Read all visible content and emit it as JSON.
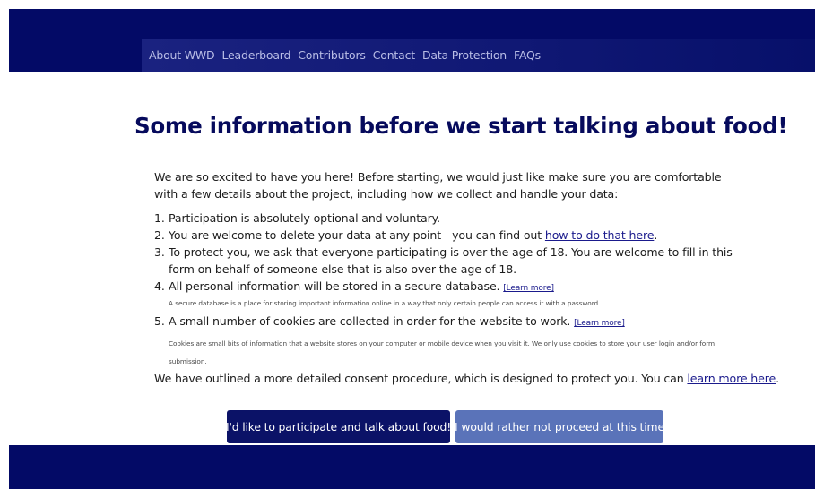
{
  "nav": {
    "items": [
      "About WWD",
      "Leaderboard",
      "Contributors",
      "Contact",
      "Data Protection",
      "FAQs"
    ]
  },
  "main": {
    "title": "Some information before we start talking about food!",
    "intro": "We are so excited to have you here! Before starting, we would just like make sure you are comfortable with a few details about the project, including how we collect and handle your data:",
    "list": {
      "item1": {
        "num": "1.",
        "text": "Participation is absolutely optional and voluntary."
      },
      "item2": {
        "num": "2.",
        "text_before": "You are welcome to delete your data at any point - you can find out ",
        "link": "how to do that here",
        "text_after": "."
      },
      "item3": {
        "num": "3.",
        "text": "To protect you, we ask that everyone participating is over the age of 18. You are welcome to fill in this form on behalf of someone else that is also over the age of 18."
      },
      "item4": {
        "num": "4.",
        "text": "All personal information will be stored in a secure database. ",
        "link": "[Learn more]",
        "note": "A secure database is a place for storing important information online in a way that only certain people can access it with a password."
      },
      "item5": {
        "num": "5.",
        "text": "A small number of cookies are collected in order for the website to work. ",
        "link": "[Learn more]",
        "note": "Cookies are small bits of information that a website stores on your computer or mobile device when you visit it. We only use cookies to store your user login and/or form submission."
      }
    },
    "outro_before": "We have outlined a more detailed consent procedure, which is designed to protect you. You can ",
    "outro_link": "learn more here",
    "outro_after": "."
  },
  "buttons": {
    "participate": "I'd like to participate and talk about food!",
    "decline": "I would rather not proceed at this time"
  },
  "colors": {
    "header": "#030a66",
    "title": "#060a5c",
    "primary_button": "#0b1267",
    "secondary_button": "#5a73b9",
    "link": "#1a1a8c"
  }
}
